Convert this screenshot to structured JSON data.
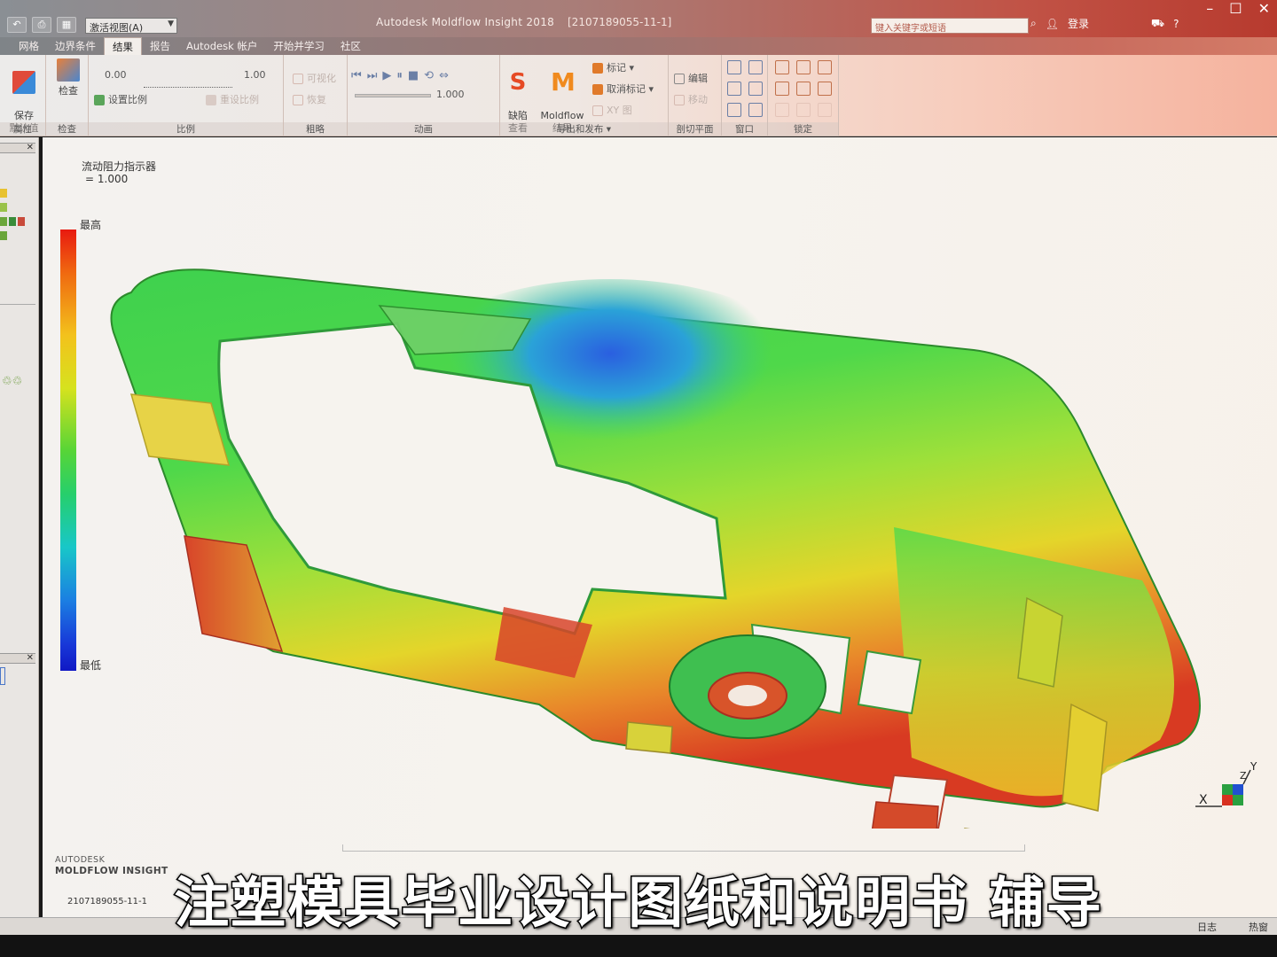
{
  "titlebar": {
    "view_selector": "激活视图(A)",
    "app_title": "Autodesk Moldflow Insight 2018",
    "document": "[2107189055-11-1]",
    "search_placeholder": "键入关键字或短语",
    "login": "登录"
  },
  "tabs": [
    "网格",
    "边界条件",
    "结果",
    "报告",
    "Autodesk 帐户",
    "开始并学习",
    "社区"
  ],
  "active_tab": "结果",
  "ribbon": {
    "save_default": "保存\n默认值",
    "inspect": "检查",
    "scale_min": "0.00",
    "scale_max": "1.00",
    "set_scale": "设置比例",
    "reset_scale": "重设比例",
    "visualize": "可视化",
    "restore": "恢复",
    "anim_value": "1.000",
    "defect_view": "缺陷\n查看",
    "moldflow_results": "Moldflow\n结果",
    "mark": "标记",
    "unmark": "取消标记",
    "xy_plot": "XY 图",
    "edit": "编辑",
    "move": "移动",
    "groups": {
      "properties": "属性",
      "inspect": "检查",
      "scale": "比例",
      "coarse": "粗略",
      "animation": "动画",
      "export_publish": "导出和发布",
      "cutting_plane": "剖切平面",
      "window": "窗口",
      "lock": "锁定"
    }
  },
  "viewport": {
    "result_name": "流动阻力指示器",
    "result_value": "= 1.000",
    "legend_high": "最高",
    "legend_low": "最低",
    "brand_line1": "AUTODESK",
    "brand_line2": "MOLDFLOW INSIGHT",
    "study_tab": "2107189055-11-1",
    "axis_x": "X",
    "axis_y": "Y",
    "axis_z": "Z"
  },
  "statusbar": {
    "log": "日志",
    "hot": "热窗"
  },
  "subtitle": "注塑模具毕业设计图纸和说明书 辅导"
}
